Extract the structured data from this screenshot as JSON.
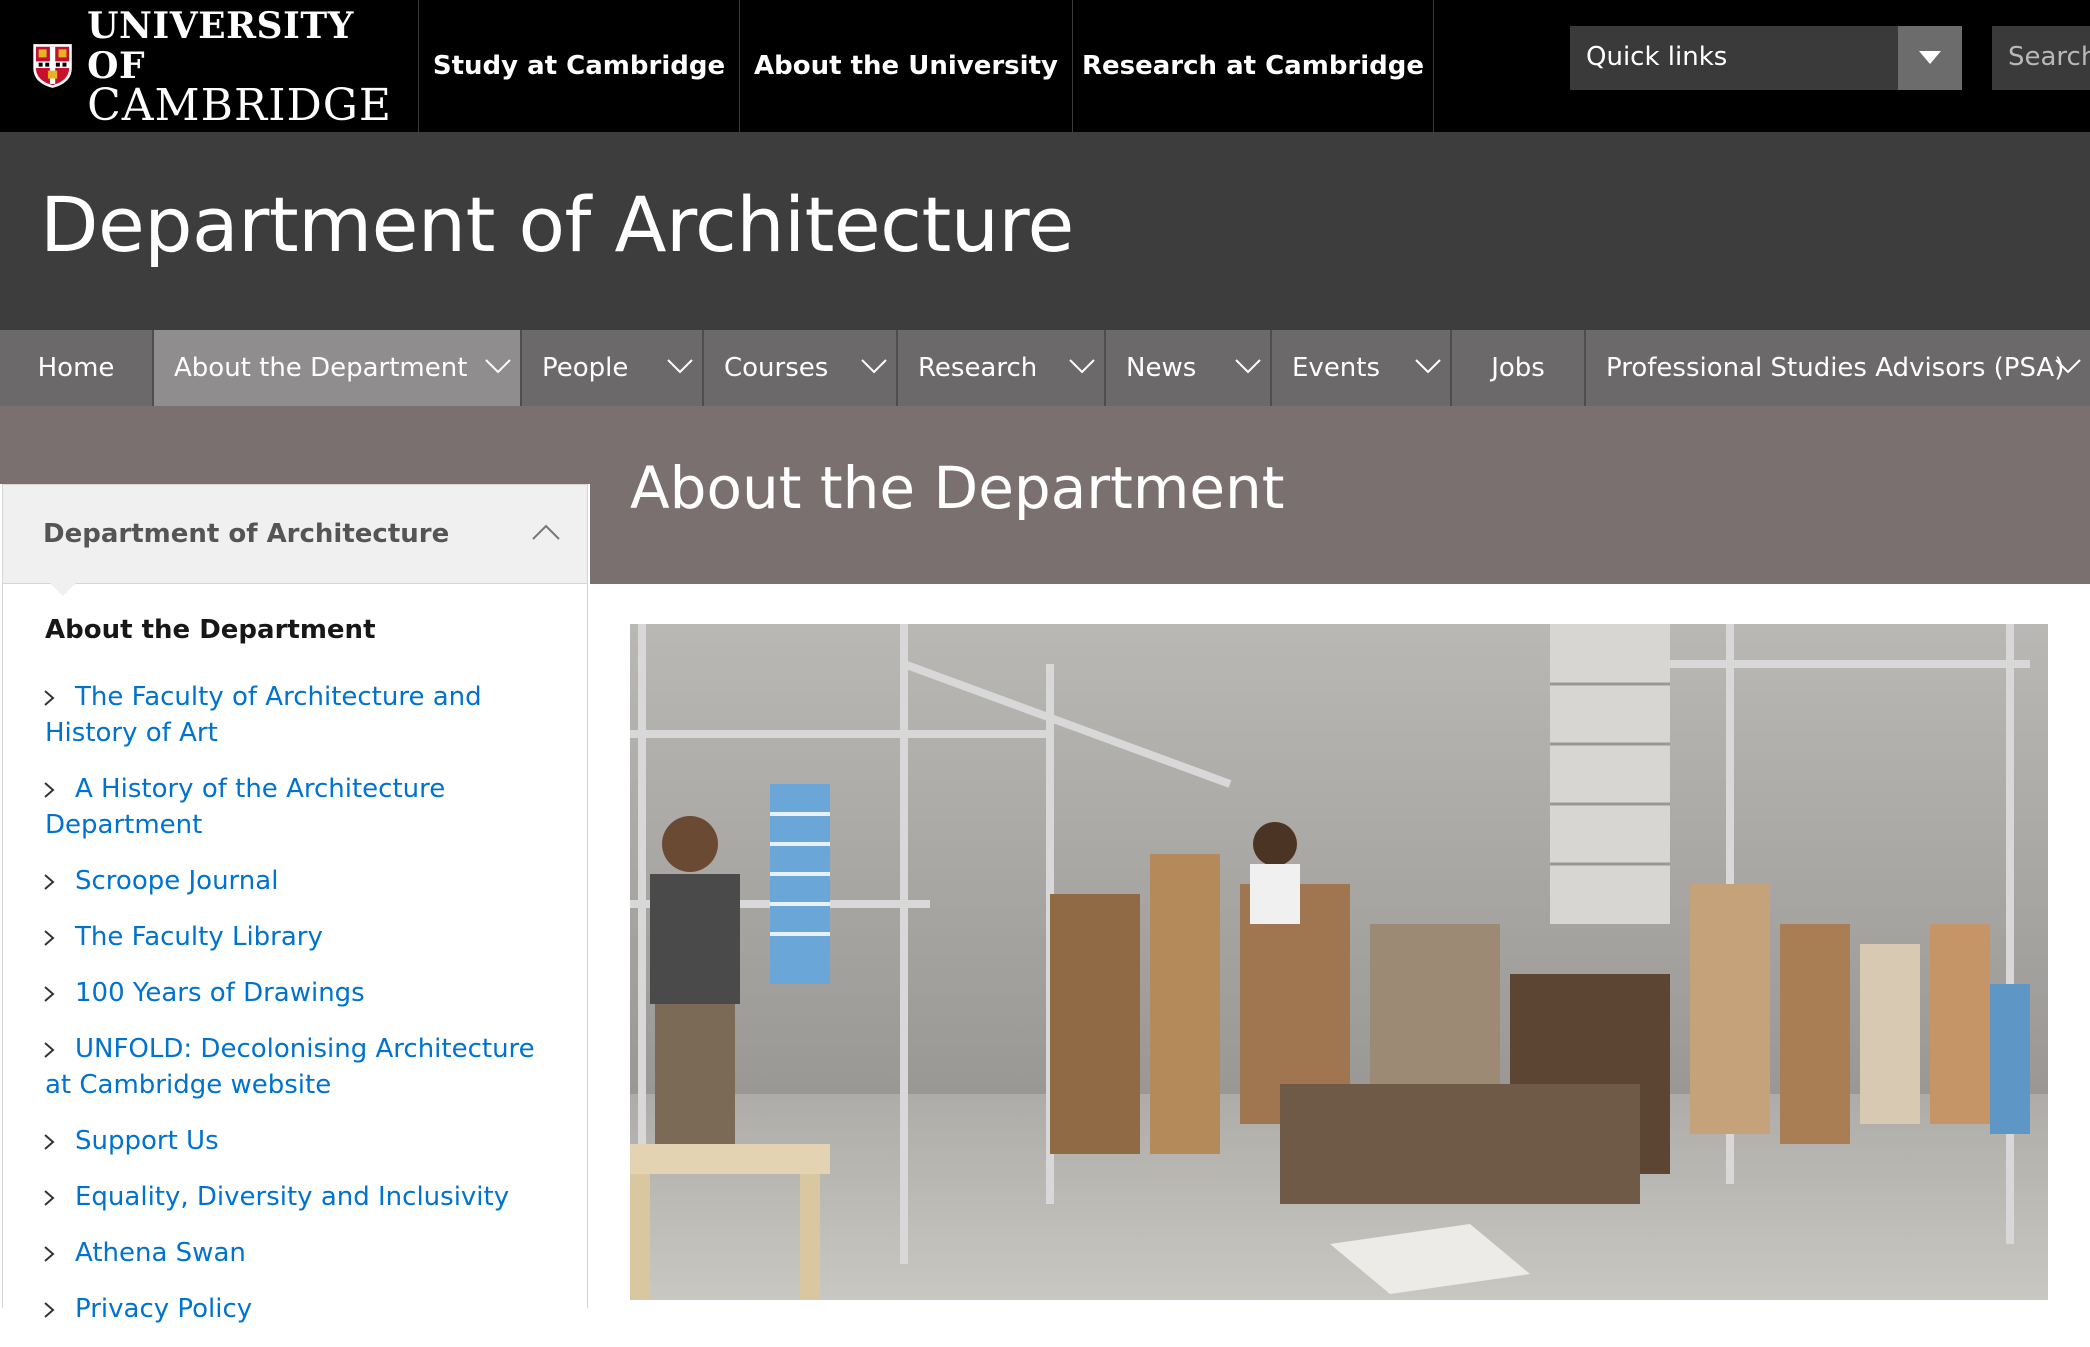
{
  "header": {
    "logo": {
      "line1": "UNIVERSITY OF",
      "line2": "CAMBRIDGE"
    },
    "nav": [
      "Study at Cambridge",
      "About the University",
      "Research at Cambridge"
    ],
    "quick_links": "Quick links",
    "search_placeholder": "Search"
  },
  "banner": {
    "title": "Department of Architecture"
  },
  "section_nav": [
    {
      "label": "Home"
    },
    {
      "label": "About the Department"
    },
    {
      "label": "People"
    },
    {
      "label": "Courses"
    },
    {
      "label": "Research"
    },
    {
      "label": "News"
    },
    {
      "label": "Events"
    },
    {
      "label": "Jobs"
    },
    {
      "label": "Professional Studies Advisors (PSA)"
    }
  ],
  "page": {
    "title": "About the Department"
  },
  "sidebar": {
    "heading": "Department of Architecture",
    "current": "About the Department",
    "links": [
      "The Faculty of Architecture and History of Art",
      "A History of the Architecture Department",
      "Scroope Journal",
      "The Faculty Library",
      "100 Years of Drawings",
      "UNFOLD: Decolonising Architecture at Cambridge website",
      "Support Us",
      "Equality, Diversity and Inclusivity",
      "Athena Swan",
      "Privacy Policy"
    ]
  },
  "colors": {
    "header_bg": "#000000",
    "banner_bg": "#3d3d3d",
    "nav_bg": "#6b6969",
    "title_band": "#7b7070",
    "link": "#0072cf"
  }
}
